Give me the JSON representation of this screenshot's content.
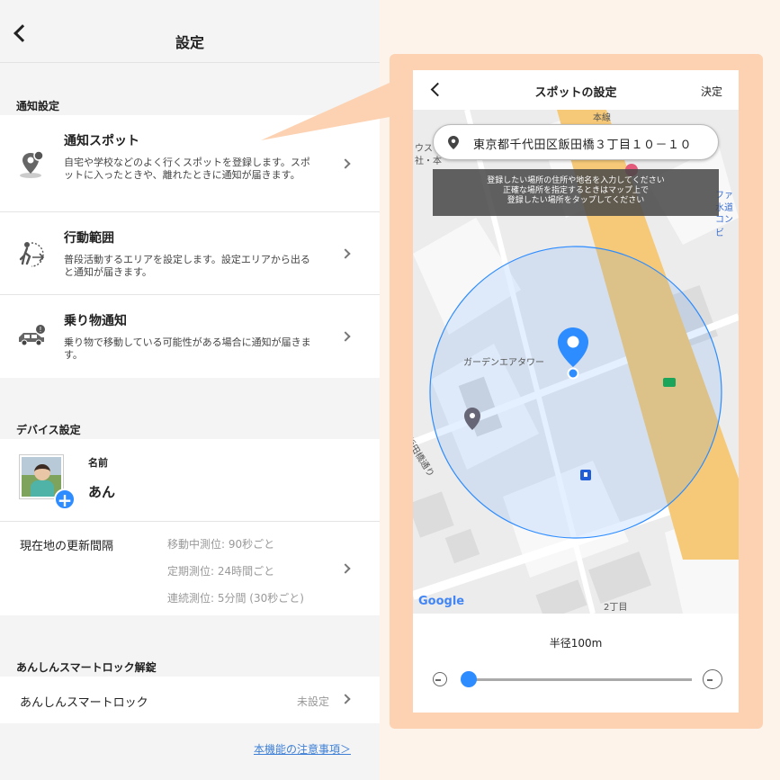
{
  "header": {
    "title": "設定"
  },
  "notification": {
    "section_title": "通知設定",
    "items": [
      {
        "icon": "map-pin-icon",
        "title": "通知スポット",
        "desc": "自宅や学校などのよく行くスポットを登録します。スポットに入ったときや、離れたときに通知が届きます。"
      },
      {
        "icon": "walking-range-icon",
        "title": "行動範囲",
        "desc": "普段活動するエリアを設定します。設定エリアから出ると通知が届きます。"
      },
      {
        "icon": "car-icon",
        "title": "乗り物通知",
        "desc": "乗り物で移動している可能性がある場合に通知が届きます。"
      }
    ]
  },
  "device": {
    "section_title": "デバイス設定",
    "name_label": "名前",
    "name_value": "あん",
    "update_label": "現在地の更新間隔",
    "update_values": [
      "移動中測位: 90秒ごと",
      "定期測位: 24時間ごと",
      "連続測位: 5分間 (30秒ごと)"
    ]
  },
  "smartlock": {
    "section_title": "あんしんスマートロック解錠",
    "label": "あんしんスマートロック",
    "value": "未設定",
    "notice_link": "本機能の注意事項＞"
  },
  "spot_screen": {
    "title": "スポットの設定",
    "done": "決定",
    "address": "東京都千代田区飯田橋３丁目１０－１０",
    "hint_lines": [
      "登録したい場所の住所や地名を入力してください",
      "正確な場所を指定するときはマップ上で",
      "登録したい場所をタップしてください"
    ],
    "map_labels": [
      "ガーデンエアタワー",
      "飯田橋通り",
      "2丁目",
      "ファ",
      "水道",
      "コンビ",
      "ウス",
      "社・本",
      "本線"
    ],
    "google": "Google",
    "radius": "半径100m",
    "radius_value_m": 100,
    "accent_color": "#2d8cff",
    "frame_color": "#fcd2b2"
  }
}
